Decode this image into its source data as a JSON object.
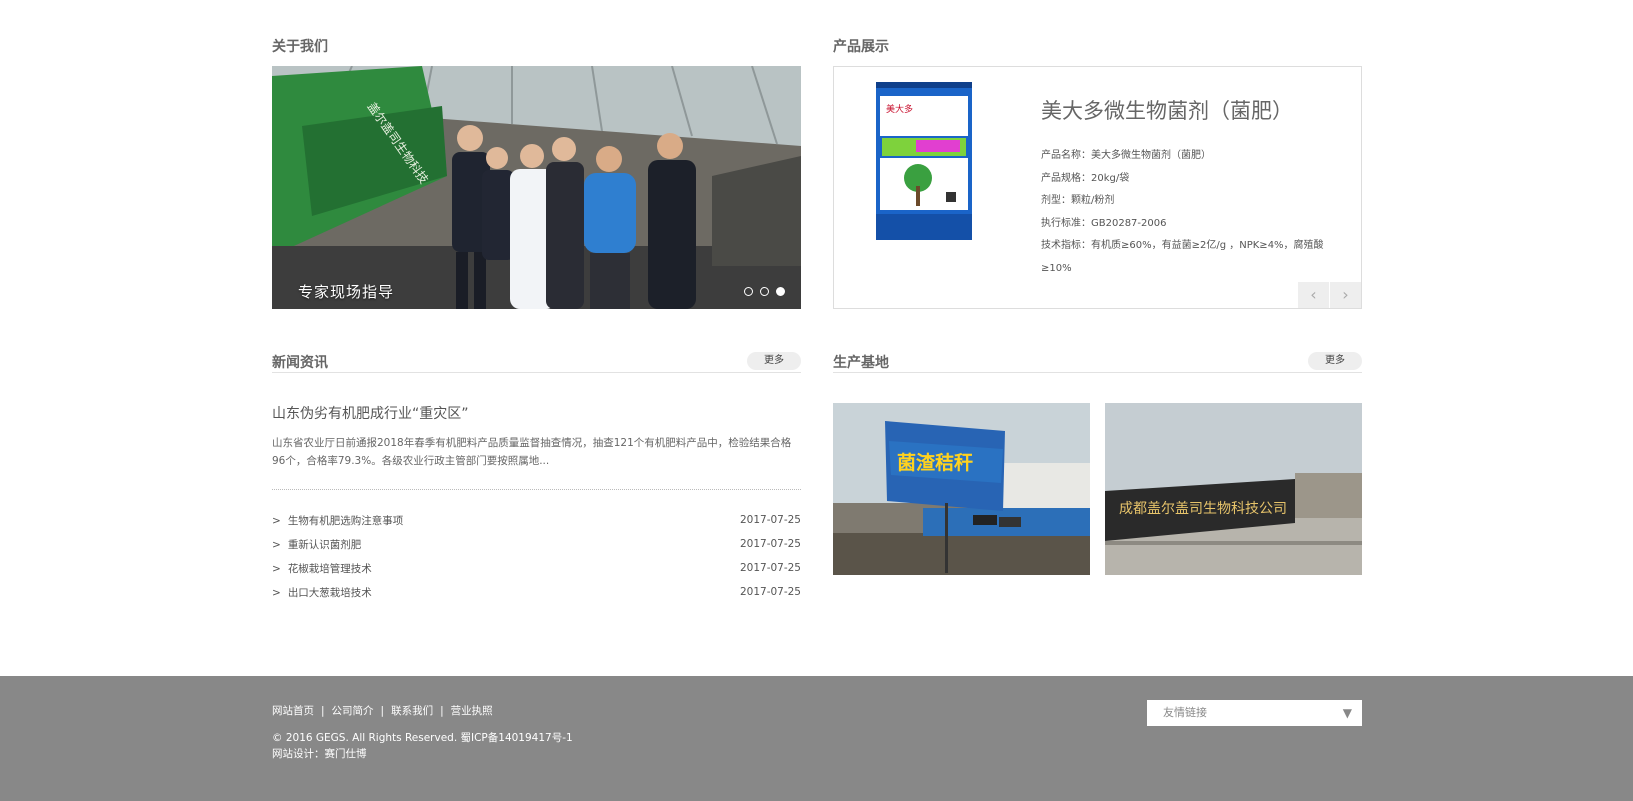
{
  "about": {
    "title": "关于我们",
    "slide_caption": "专家现场指导",
    "slide_count": 3,
    "active_slide": 3,
    "banner_text": "盖尔盖司生物科技"
  },
  "product": {
    "title": "产品展示",
    "name": "美大多微生物菌剂（菌肥）",
    "specs": [
      {
        "label": "产品名称：",
        "value": "美大多微生物菌剂（菌肥）"
      },
      {
        "label": "产品规格：",
        "value": "20kg/袋"
      },
      {
        "label": "剂型：",
        "value": "颗粒/粉剂"
      },
      {
        "label": "执行标准：",
        "value": "GB20287-2006"
      },
      {
        "label": "技术指标：",
        "value": "有机质≥60%，有益菌≥2亿/g ，NPK≥4%，腐殖酸≥10%"
      }
    ],
    "prev_icon": "‹",
    "next_icon": "›"
  },
  "news": {
    "title": "新闻资讯",
    "more_label": "更多",
    "feature_title": "山东伪劣有机肥成行业“重灾区”",
    "feature_text": "山东省农业厅日前通报2018年春季有机肥料产品质量监督抽查情况，抽查121个有机肥料产品中，检验结果合格96个，合格率79.3%。各级农业行政主管部门要按照属地...",
    "items": [
      {
        "title": "生物有机肥选购注意事项",
        "date": "2017-07-25"
      },
      {
        "title": "重新认识菌剂肥",
        "date": "2017-07-25"
      },
      {
        "title": "花椒栽培管理技术",
        "date": "2017-07-25"
      },
      {
        "title": "出口大葱栽培技术",
        "date": "2017-07-25"
      }
    ]
  },
  "base": {
    "title": "生产基地",
    "more_label": "更多",
    "sign1": "菌渣秸秆",
    "sign2": "成都盖尔盖司生物科技公司"
  },
  "footer": {
    "links": [
      "网站首页",
      "公司简介",
      "联系我们",
      "营业执照"
    ],
    "separator": "|",
    "copyright": "© 2016 GEGS. All Rights Reserved. 蜀ICP备14019417号-1",
    "designer": "网站设计：赛门仕博",
    "friend_links_label": "友情链接"
  },
  "colors": {
    "footer_bg": "#888888",
    "bag_blue": "#1a64c8",
    "bag_green": "#7ed23c"
  }
}
